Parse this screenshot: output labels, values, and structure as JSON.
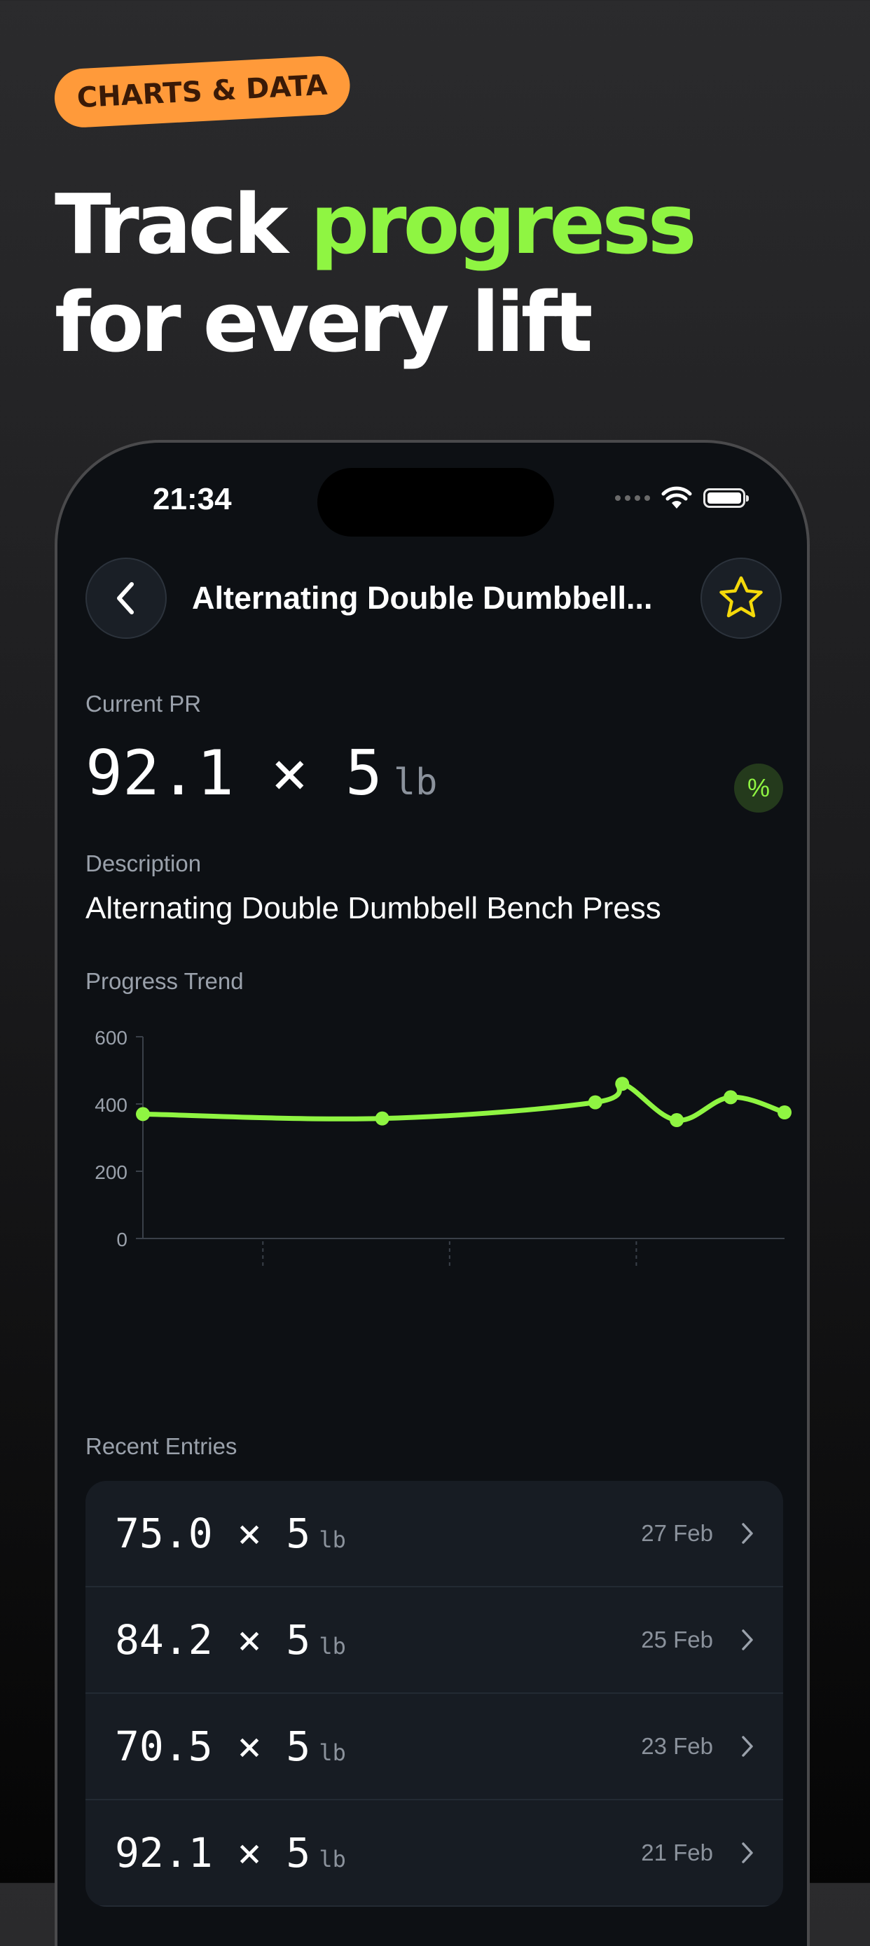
{
  "promo": {
    "badge": "CHARTS & DATA",
    "headline_1": "Track ",
    "headline_accent": "progress",
    "headline_2": "for every lift"
  },
  "status_bar": {
    "time": "21:34"
  },
  "nav": {
    "title": "Alternating Double Dumbbell..."
  },
  "current_pr": {
    "label": "Current PR",
    "value": "92.1 × 5",
    "unit": "lb",
    "badge": "%"
  },
  "description": {
    "label": "Description",
    "text": "Alternating Double Dumbbell Bench Press"
  },
  "progress": {
    "label": "Progress Trend"
  },
  "chart_data": {
    "type": "line",
    "ylim": [
      0,
      600
    ],
    "yticks": [
      0,
      200,
      400,
      600
    ],
    "xlim": [
      0,
      100
    ],
    "values": [
      {
        "x": 0,
        "y": 370
      },
      {
        "x": 37.3,
        "y": 357
      },
      {
        "x": 70.5,
        "y": 405
      },
      {
        "x": 74.7,
        "y": 460
      },
      {
        "x": 83.2,
        "y": 352
      },
      {
        "x": 91.6,
        "y": 420
      },
      {
        "x": 100,
        "y": 375
      }
    ],
    "x_ticks": [
      18.7,
      47.8,
      76.9
    ],
    "color": "#8ff542",
    "grid": false
  },
  "recent": {
    "label": "Recent Entries",
    "entries": [
      {
        "value": "75.0 × 5",
        "unit": "lb",
        "date": "27 Feb"
      },
      {
        "value": "84.2 × 5",
        "unit": "lb",
        "date": "25 Feb"
      },
      {
        "value": "70.5 × 5",
        "unit": "lb",
        "date": "23 Feb"
      },
      {
        "value": "92.1 × 5",
        "unit": "lb",
        "date": "21 Feb"
      }
    ]
  },
  "colors": {
    "accent": "#8ff542",
    "badge": "#ff9a3a",
    "star": "#f5d90a",
    "background": "#0d1014"
  }
}
